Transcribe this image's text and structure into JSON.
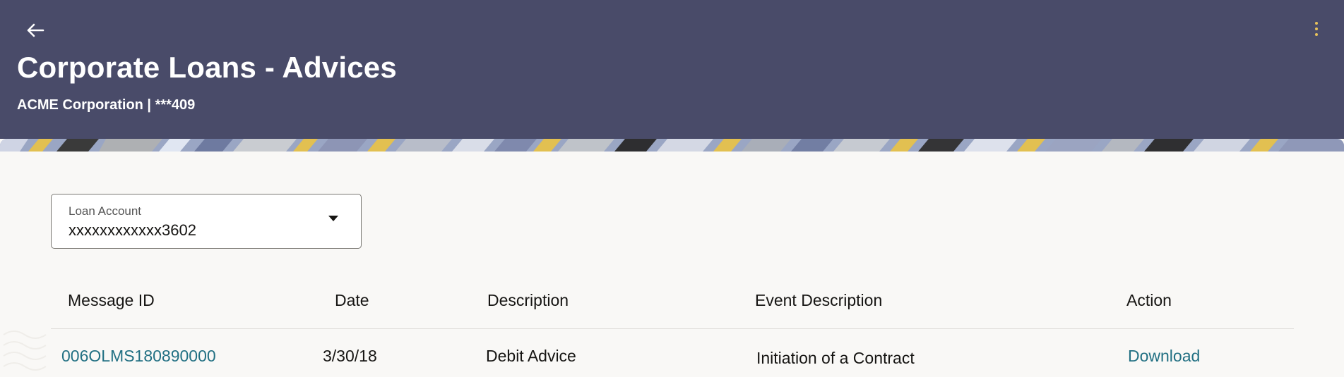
{
  "header": {
    "title": "Corporate Loans - Advices",
    "subtitle": "ACME Corporation | ***409",
    "background": "#494b69",
    "menu_dot_color": "#e8c25a"
  },
  "filter": {
    "label": "Loan Account",
    "value": "xxxxxxxxxxxx3602"
  },
  "table": {
    "columns": [
      "Message ID",
      "Date",
      "Description",
      "Event Description",
      "Action"
    ],
    "rows": [
      {
        "message_id": "006OLMS180890000",
        "date": "3/30/18",
        "description": "Debit Advice",
        "event_description": "Initiation of a Contract",
        "action": "Download"
      }
    ]
  },
  "colors": {
    "link": "#227083",
    "page_background": "#f9f8f6"
  }
}
